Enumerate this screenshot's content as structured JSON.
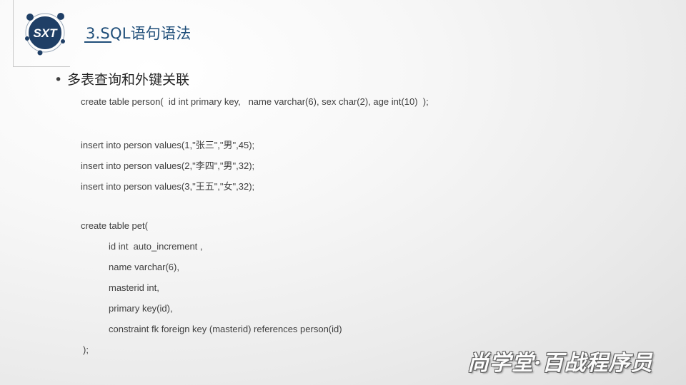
{
  "slide": {
    "title": "3.SQL语句语法",
    "logo_text": "SXT",
    "bullet": {
      "dot": "•",
      "heading": "多表查询和外键关联"
    },
    "code_lines": [
      "create table person(  id int primary key,   name varchar(6), sex char(2), age int(10)  );",
      "insert into person values(1,\"张三\",\"男\",45);",
      "insert into person values(2,\"李四\",\"男\",32);",
      "insert into person values(3,\"王五\",\"女\",32);",
      "create table pet(",
      "id int  auto_increment ,",
      "name varchar(6),",
      "masterid int,",
      "primary key(id),",
      "constraint fk foreign key (masterid) references person(id)",
      ");"
    ],
    "watermark": "尚学堂·百战程序员"
  },
  "colors": {
    "title": "#1f4e79",
    "logo_fill": "#1f3f66",
    "text": "#404040"
  }
}
